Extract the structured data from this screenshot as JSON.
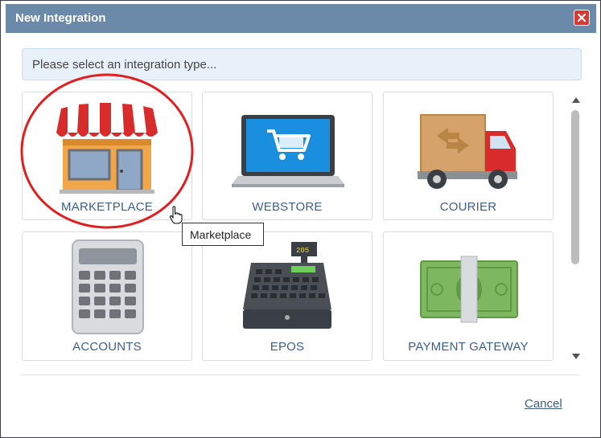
{
  "dialog": {
    "title": "New Integration",
    "close_icon": "close-icon",
    "prompt": "Please select an integration type...",
    "cancel_label": "Cancel"
  },
  "tiles": [
    {
      "label": "MARKETPLACE",
      "icon": "shop-icon"
    },
    {
      "label": "WEBSTORE",
      "icon": "laptop-cart-icon"
    },
    {
      "label": "COURIER",
      "icon": "truck-icon"
    },
    {
      "label": "ACCOUNTS",
      "icon": "calculator-icon"
    },
    {
      "label": "EPOS",
      "icon": "cash-register-icon"
    },
    {
      "label": "PAYMENT GATEWAY",
      "icon": "money-icon"
    }
  ],
  "tooltip": "Marketplace",
  "cash_register_display": "205",
  "colors": {
    "titlebar": "#6b89a8",
    "close_button": "#d63a34",
    "label_text": "#3f5e86",
    "highlight_circle": "#e02020"
  }
}
